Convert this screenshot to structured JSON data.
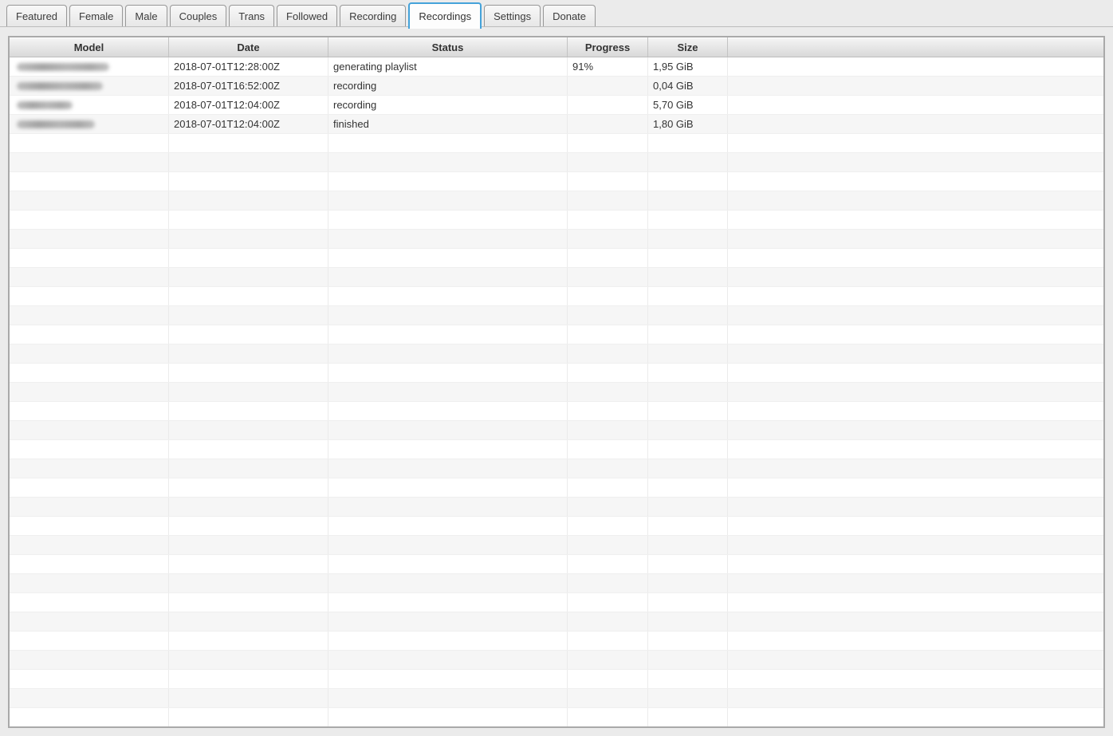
{
  "window": {
    "background_color": "#ebebeb",
    "accent_color": "#44a2da"
  },
  "tabs": {
    "items": [
      {
        "label": "Featured",
        "selected": false
      },
      {
        "label": "Female",
        "selected": false
      },
      {
        "label": "Male",
        "selected": false
      },
      {
        "label": "Couples",
        "selected": false
      },
      {
        "label": "Trans",
        "selected": false
      },
      {
        "label": "Followed",
        "selected": false
      },
      {
        "label": "Recording",
        "selected": false
      },
      {
        "label": "Recordings",
        "selected": true
      },
      {
        "label": "Settings",
        "selected": false
      },
      {
        "label": "Donate",
        "selected": false
      }
    ]
  },
  "table": {
    "columns": [
      "Model",
      "Date",
      "Status",
      "Progress",
      "Size",
      ""
    ],
    "rows": [
      {
        "model_redacted": true,
        "redaction_width": 116,
        "date": "2018-07-01T12:28:00Z",
        "status": "generating playlist",
        "progress": "91%",
        "size": "1,95 GiB"
      },
      {
        "model_redacted": true,
        "redaction_width": 108,
        "date": "2018-07-01T16:52:00Z",
        "status": "recording",
        "progress": "",
        "size": "0,04 GiB"
      },
      {
        "model_redacted": true,
        "redaction_width": 70,
        "date": "2018-07-01T12:04:00Z",
        "status": "recording",
        "progress": "",
        "size": "5,70 GiB"
      },
      {
        "model_redacted": true,
        "redaction_width": 98,
        "date": "2018-07-01T12:04:00Z",
        "status": "finished",
        "progress": "",
        "size": "1,80 GiB"
      }
    ],
    "empty_row_count": 31
  }
}
